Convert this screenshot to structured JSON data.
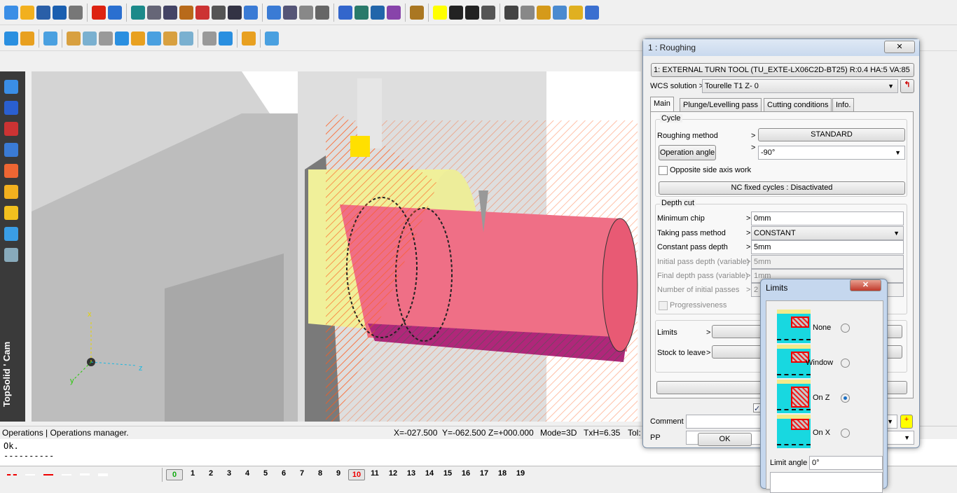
{
  "app": {
    "brand": "TopSolid ' Cam"
  },
  "toolbar": {
    "row1_icons": [
      "new-icon",
      "open-icon",
      "save-icon",
      "info-icon",
      "print-icon",
      "delete-icon",
      "undo-icon",
      "refresh-icon",
      "zoom-icon",
      "settings-icon",
      "measure-icon",
      "tool-icon",
      "clock-icon",
      "cut-icon",
      "point-icon",
      "cross-icon",
      "bars-icon",
      "hook-icon",
      "text-icon",
      "zoom-in-icon",
      "fit-icon",
      "export-icon",
      "view-icon",
      "layer-icon",
      "color-swatch-icon",
      "dot-icon",
      "line-icon",
      "hatch-icon",
      "cam-icon",
      "gear-icon",
      "chart-icon",
      "doc-icon",
      "light-icon",
      "figure-icon"
    ],
    "row2_icons": [
      "part-icon",
      "stock-icon",
      "shape-icon",
      "tool1-icon",
      "tool2-icon",
      "tool3-icon",
      "tool4-icon",
      "tool5-icon",
      "tool6-icon",
      "tool7-icon",
      "tool8-icon",
      "target-icon",
      "machine-icon",
      "nc-icon",
      "nc-code-icon"
    ],
    "accent_color": "#ffff00"
  },
  "left_toolbar": {
    "icons": [
      "pencil-icon",
      "cube-icon",
      "surface-icon",
      "assembly-icon",
      "cam-operation-icon",
      "fixture-icon",
      "folder-icon",
      "book-icon",
      "simulation-icon"
    ]
  },
  "viewport": {
    "axes": {
      "x": "x",
      "y": "y",
      "z": "z"
    }
  },
  "status": {
    "left": "Operations | Operations manager.",
    "x": "X=-027.500",
    "y": "Y=-062.500",
    "z": "Z=+000.000",
    "mode": "Mode=3D",
    "txh": "TxH=6.35",
    "tol": "Tol:"
  },
  "command": {
    "lines": [
      "Ok.",
      "----------"
    ]
  },
  "layers": {
    "items": [
      "0",
      "1",
      "2",
      "3",
      "4",
      "5",
      "6",
      "7",
      "8",
      "9",
      "10",
      "11",
      "12",
      "13",
      "14",
      "15",
      "16",
      "17",
      "18",
      "19"
    ],
    "current": "0",
    "active": "10"
  },
  "roughing": {
    "title": "1 : Roughing",
    "tool": "1: EXTERNAL TURN TOOL (TU_EXTE-LX06C2D-BT25)  R:0.4  HA:5  VA:85",
    "wcs_label": "WCS solution >",
    "wcs_value": "Tourelle T1  Z-   0",
    "tabs": [
      "Main",
      "Plunge/Levelling pass",
      "Cutting conditions",
      "Info."
    ],
    "cycle": {
      "title": "Cycle",
      "method_label": "Roughing method",
      "method_value": "STANDARD",
      "angle_button": "Operation angle",
      "angle_value": "-90°",
      "opposite_label": "Opposite side axis work",
      "opposite_checked": false,
      "nc_button": "NC fixed cycles : Disactivated"
    },
    "depth": {
      "title": "Depth cut",
      "rows": [
        {
          "label": "Minimum chip",
          "value": "0mm",
          "enabled": true
        },
        {
          "label": "Taking pass method",
          "value": "CONSTANT",
          "enabled": true
        },
        {
          "label": "Constant pass depth",
          "value": "5mm",
          "enabled": true
        },
        {
          "label": "Initial pass depth (variable)",
          "value": "5mm",
          "enabled": false
        },
        {
          "label": "Final depth pass (variable)",
          "value": "1mm",
          "enabled": false
        },
        {
          "label": "Number of initial passes",
          "value": "2",
          "enabled": false
        }
      ],
      "progressive_label": "Progressiveness"
    },
    "limits_label": "Limits",
    "stock_label": "Stock to leave",
    "comment_label": "Comment :",
    "comment_value": "",
    "pp_label": "PP",
    "pp_value": "",
    "ok": "OK"
  },
  "limits": {
    "title": "Limits",
    "options": [
      {
        "label": "None",
        "selected": false
      },
      {
        "label": "Window",
        "selected": false
      },
      {
        "label": "On Z",
        "selected": true
      },
      {
        "label": "On X",
        "selected": false
      }
    ],
    "angle_label": "Limit angle :",
    "angle_value": "0°"
  }
}
